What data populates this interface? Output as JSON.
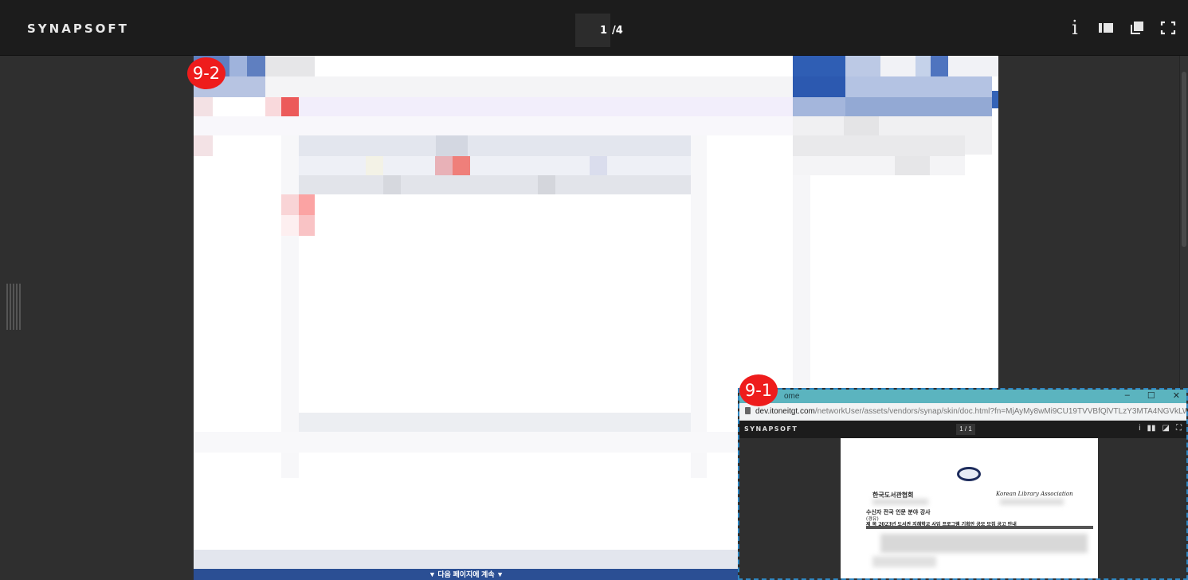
{
  "app": {
    "brand": "SYNAPSOFT",
    "page_current": "1",
    "page_total": "/4"
  },
  "toolbar": {
    "info_icon": "i",
    "icons": [
      "info-icon",
      "sidebar-view-icon",
      "copy-icon",
      "fullscreen-icon"
    ]
  },
  "annotations": {
    "badge_main": "9-2",
    "badge_inset": "9-1"
  },
  "document": {
    "next_page_label": "▼ 다음 페이지에 계속 ▼"
  },
  "inset": {
    "window_title_suffix": "ome",
    "url_prefix": "dev.itoneitgt.com",
    "url_rest": "/networkUser/assets/vendors/synap/skin/doc.html?fn=MjAyMy8wMi9CU19TVVBfQlVTLzY3MTA4NGVkLWFhOWQtNDEwZ...",
    "brand": "SYNAPSOFT",
    "page": "1 / 1",
    "window_controls": [
      "–",
      "☐",
      "✕"
    ],
    "org_korean": "한국도서관협회",
    "org_english": "Korean Library Association",
    "recipient": "수신자  전국 인문 분야 강사",
    "via": "(경유)",
    "subject": "제  목   2023년 도서관 지혜학교 사업 프로그램 기획안 공모 모집 공고 안내"
  },
  "colors": {
    "topbar": "#1c1c1c",
    "badge": "#ee1c1c",
    "inset_border": "#2e86c1",
    "next_bar": "#2b4f94"
  }
}
